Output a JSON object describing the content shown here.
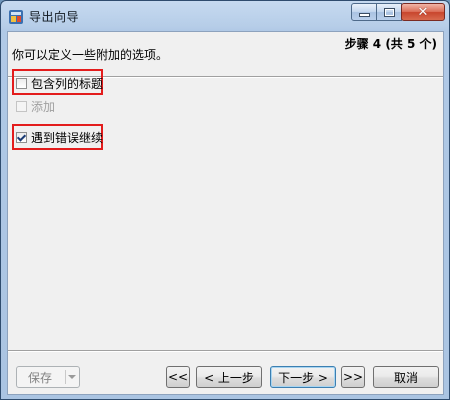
{
  "window": {
    "title": "导出向导"
  },
  "header": {
    "step_text": "步骤 4 (共 5 个)",
    "description": "你可以定义一些附加的选项。"
  },
  "options": [
    {
      "label": "包含列的标题",
      "checked": false,
      "enabled": true
    },
    {
      "label": "添加",
      "checked": false,
      "enabled": false
    },
    {
      "label": "遇到错误继续",
      "checked": true,
      "enabled": true
    }
  ],
  "footer": {
    "save_label": "保存",
    "first_label": "<<",
    "prev_label": "< 上一步",
    "next_label": "下一步 >",
    "last_label": ">>",
    "cancel_label": "取消"
  },
  "colors": {
    "highlight": "#e31c1c",
    "titlebar": "#b6cde8",
    "close_button": "#c8452d"
  }
}
